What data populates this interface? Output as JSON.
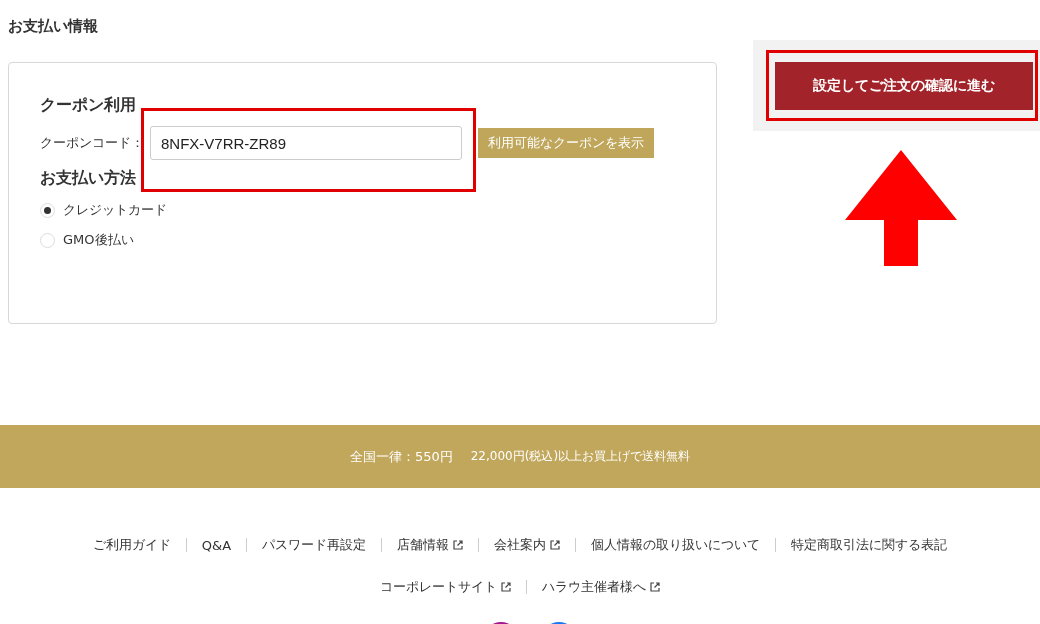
{
  "section_title": "お支払い情報",
  "coupon": {
    "heading": "クーポン利用",
    "label": "クーポンコード：",
    "value": "8NFX-V7RR-ZR89",
    "show_button": "利用可能なクーポンを表示"
  },
  "payment": {
    "heading": "お支払い方法",
    "options": [
      {
        "label": "クレジットカード",
        "selected": true
      },
      {
        "label": "GMO後払い",
        "selected": false
      }
    ]
  },
  "confirm_button": "設定してご注文の確認に進む",
  "shipping_banner": {
    "flat_rate": "全国一律：550円",
    "free_shipping": "22,000円(税込)以上お買上げで送料無料"
  },
  "footer_links": [
    [
      {
        "label": "ご利用ガイド",
        "external": false
      },
      {
        "label": "Q&A",
        "external": false
      },
      {
        "label": "パスワード再設定",
        "external": false
      },
      {
        "label": "店舗情報",
        "external": true
      },
      {
        "label": "会社案内",
        "external": true
      },
      {
        "label": "個人情報の取り扱いについて",
        "external": false
      },
      {
        "label": "特定商取引法に関する表記",
        "external": false
      }
    ],
    [
      {
        "label": "コーポレートサイト",
        "external": true
      },
      {
        "label": "ハラウ主催者様へ",
        "external": true
      }
    ]
  ]
}
